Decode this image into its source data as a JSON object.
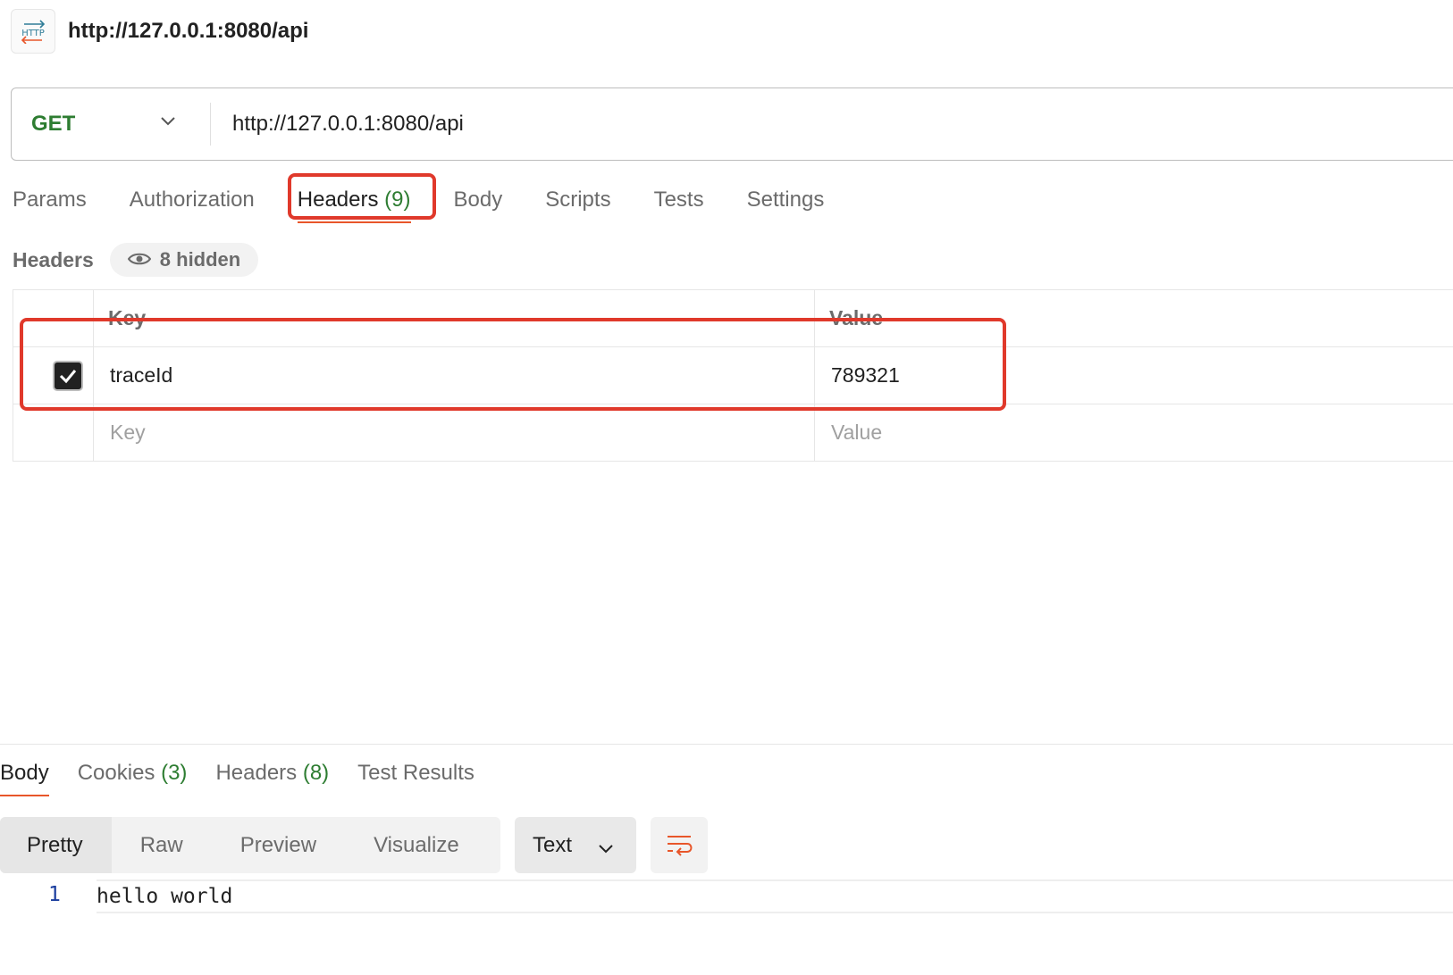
{
  "request": {
    "title": "http://127.0.0.1:8080/api",
    "icon": "http-icon",
    "method": "GET",
    "url": "http://127.0.0.1:8080/api"
  },
  "request_tabs": [
    {
      "label": "Params",
      "count": ""
    },
    {
      "label": "Authorization",
      "count": ""
    },
    {
      "label": "Headers",
      "count": "(9)",
      "active": true
    },
    {
      "label": "Body",
      "count": ""
    },
    {
      "label": "Scripts",
      "count": ""
    },
    {
      "label": "Tests",
      "count": ""
    },
    {
      "label": "Settings",
      "count": ""
    }
  ],
  "headers_section": {
    "title": "Headers",
    "hidden_label": "8 hidden"
  },
  "headers_table": {
    "columns": [
      "Key",
      "Value"
    ],
    "rows": [
      {
        "checked": true,
        "key": "traceId",
        "value": "789321"
      }
    ],
    "placeholder_key": "Key",
    "placeholder_value": "Value"
  },
  "response_tabs": [
    {
      "label": "Body",
      "count": "",
      "active": true
    },
    {
      "label": "Cookies",
      "count": "(3)"
    },
    {
      "label": "Headers",
      "count": "(8)"
    },
    {
      "label": "Test Results",
      "count": ""
    }
  ],
  "view_modes": [
    "Pretty",
    "Raw",
    "Preview",
    "Visualize"
  ],
  "active_view_mode": "Pretty",
  "format": "Text",
  "response_body": {
    "lines": [
      {
        "num": "1",
        "text": "hello world"
      }
    ]
  },
  "colors": {
    "method_get": "#2e7d32",
    "count": "#2e7d32",
    "active_tab_underline": "#e8562a",
    "annotation_box": "#e0392b",
    "line_number": "#1a3d9e"
  }
}
